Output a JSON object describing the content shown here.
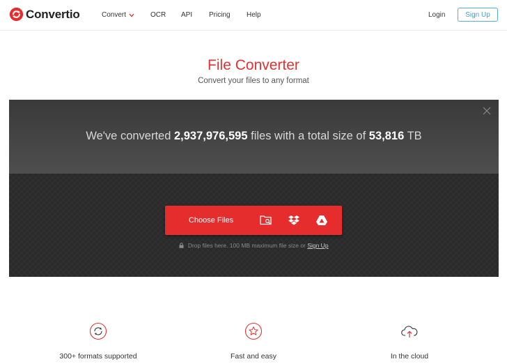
{
  "header": {
    "logo_text": "Convertio",
    "nav": {
      "convert": "Convert",
      "ocr": "OCR",
      "api": "API",
      "pricing": "Pricing",
      "help": "Help"
    },
    "login": "Login",
    "signup": "Sign Up"
  },
  "hero": {
    "title": "File Converter",
    "subtitle": "Convert your files to any format"
  },
  "stats": {
    "prefix": "We've converted",
    "files_count": "2,937,976,595",
    "middle": "files with a total size of",
    "total_size": "53,816",
    "unit": "TB"
  },
  "upload": {
    "choose_label": "Choose Files",
    "sources": [
      "folder-search-icon",
      "dropbox-icon",
      "google-drive-icon"
    ],
    "drop_note": "Drop files here. 100 MB maximum file size or",
    "drop_link": "Sign Up"
  },
  "features": [
    {
      "icon": "refresh-circle-icon",
      "label": "300+ formats supported"
    },
    {
      "icon": "star-circle-icon",
      "label": "Fast and easy"
    },
    {
      "icon": "cloud-upload-icon",
      "label": "In the cloud"
    }
  ],
  "colors": {
    "brand_red": "#e52d2d",
    "title_red": "#e03232",
    "signup_blue": "#3aa2cf",
    "panel_dark": "#2f2f2f"
  }
}
